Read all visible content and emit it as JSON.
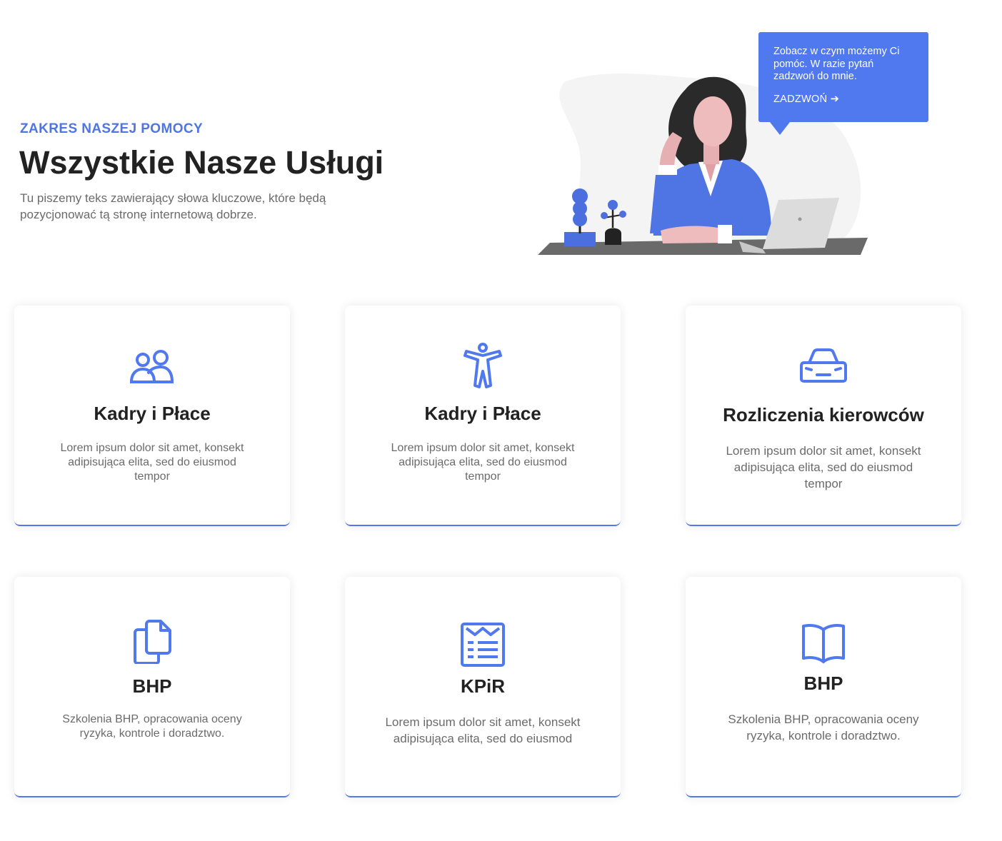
{
  "section": {
    "eyebrow": "ZAKRES NASZEJ POMOCY",
    "title": "Wszystkie Nasze Usługi",
    "intro": "Tu piszemy teks zawierający słowa kluczowe, które będą pozycjonować tą stronę internetową dobrze."
  },
  "bubble": {
    "text": "Zobacz w czym możemy Ci pomóc. W razie pytań zadzwoń do mnie.",
    "cta": "ZADZWOŃ ➔"
  },
  "cards": [
    {
      "icon": "users-icon",
      "title": "Kadry i Płace",
      "text": "Lorem ipsum dolor sit amet, konsekt adipisująca elita, sed do eiusmod tempor"
    },
    {
      "icon": "accessibility-icon",
      "title": "Kadry i Płace",
      "text": "Lorem ipsum dolor sit amet, konsekt adipisująca elita, sed do eiusmod tempor"
    },
    {
      "icon": "car-icon",
      "title": "Rozliczenia kierowców",
      "text": "Lorem ipsum dolor sit amet, konsekt adipisująca elita, sed do eiusmod tempor"
    },
    {
      "icon": "documents-icon",
      "title": "BHP",
      "text": "Szkolenia BHP, opracowania oceny ryzyka, kontrole i doradztwo."
    },
    {
      "icon": "newspaper-icon",
      "title": "KPiR",
      "text": "Lorem ipsum dolor sit amet, konsekt adipisująca elita, sed do eiusmod"
    },
    {
      "icon": "book-icon",
      "title": "BHP",
      "text": "Szkolenia BHP, opracowania oceny ryzyka, kontrole i doradztwo."
    }
  ],
  "colors": {
    "accent": "#5078ef",
    "heading": "#222222",
    "body": "#6b6b6b"
  }
}
